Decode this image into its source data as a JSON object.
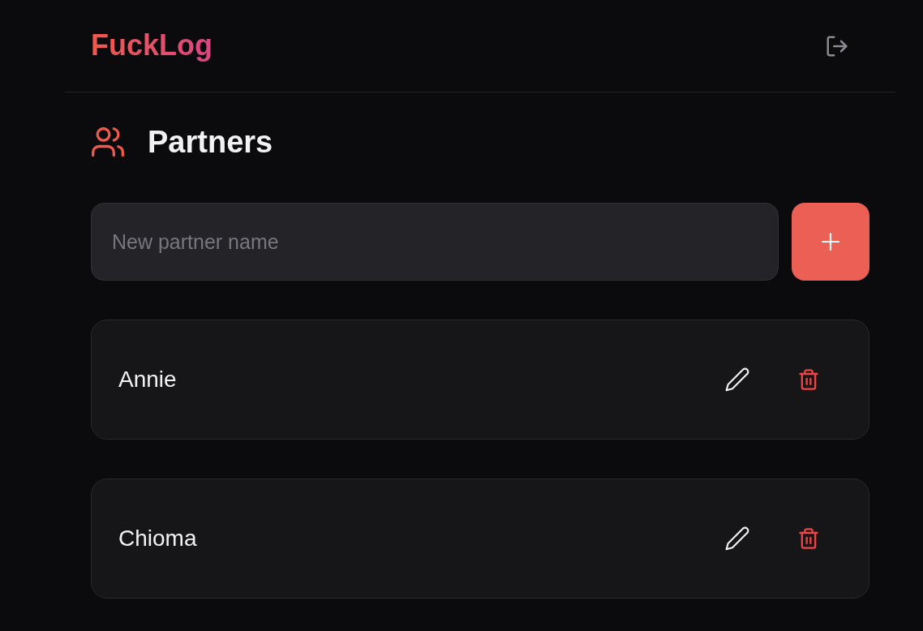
{
  "header": {
    "logo": "FuckLog"
  },
  "page": {
    "title": "Partners"
  },
  "new_partner": {
    "placeholder": "New partner name"
  },
  "partners": [
    {
      "name": "Annie"
    },
    {
      "name": "Chioma"
    }
  ]
}
